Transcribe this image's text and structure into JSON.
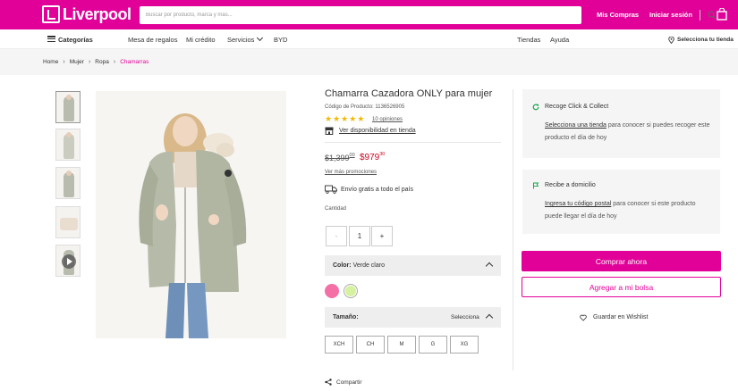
{
  "brand": {
    "name": "Liverpool",
    "color": "#e10098"
  },
  "search": {
    "placeholder": "Buscar por producto, marca y más..."
  },
  "header": {
    "my_orders": "Mis Compras",
    "login": "Iniciar sesión"
  },
  "nav": {
    "categories": "Categorías",
    "gift_registry": "Mesa de regalos",
    "credit": "Mi crédito",
    "services": "Servicios",
    "byd": "BYD",
    "stores": "Tiendas",
    "help": "Ayuda",
    "select_store": "Selecciona tu tienda"
  },
  "breadcrumb": [
    "Home",
    "Mujer",
    "Ropa",
    "Chamarras"
  ],
  "product": {
    "title": "Chamarra Cazadora ONLY para mujer",
    "code": "Código de Producto: 1136526905",
    "rating": 5,
    "reviews": "10 opiniones",
    "availability": "Ver disponibilidad en tienda",
    "old_price": "$1,399",
    "old_price_cents": "00",
    "price": "$979",
    "price_cents": "30",
    "promotions": "Ver más promociones",
    "shipping": "Envío gratis a todo el país",
    "quantity_label": "Cantidad",
    "quantity": "1",
    "minus": "-",
    "plus": "+",
    "color_label": "Color:",
    "color_value": "Verde claro",
    "swatches": [
      {
        "name": "rosa",
        "hex": "#f36fa6"
      },
      {
        "name": "verde claro",
        "hex": "#d6f2a0"
      }
    ],
    "size_label": "Tamaño:",
    "size_select": "Selecciona",
    "sizes": [
      "XCH",
      "CH",
      "M",
      "G",
      "XG"
    ],
    "share": "Compartir"
  },
  "pickup": {
    "title": "Recoge Click & Collect",
    "link": "Selecciona una tienda",
    "text": "para conocer si puedes recoger este producto el día de hoy"
  },
  "delivery": {
    "title": "Recibe a domicilio",
    "link": "Ingresa tu código postal",
    "text": "para conocer si este producto puede llegar el día de hoy"
  },
  "actions": {
    "buy_now": "Comprar ahora",
    "add_to_bag": "Agregar a mi bolsa",
    "wishlist": "Guardar en Wishlist"
  }
}
